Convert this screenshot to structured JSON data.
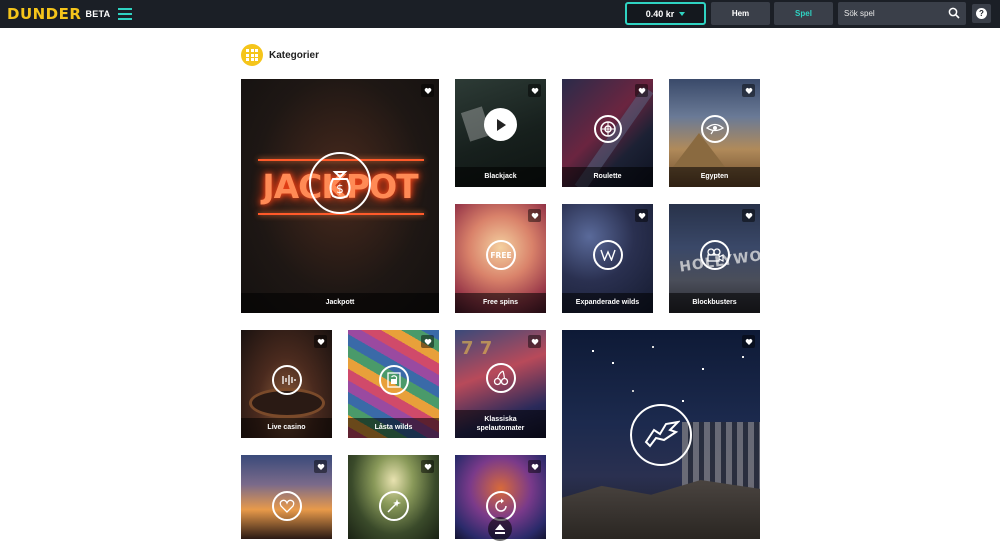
{
  "header": {
    "logo_text": "DUNDER",
    "logo_badge": "BETA",
    "balance": "0.40 kr",
    "nav_home": "Hem",
    "nav_games": "Spel",
    "search_placeholder": "Sök spel",
    "help_label": "?"
  },
  "colors": {
    "accent": "#2fd3c2",
    "brand_yellow": "#f5c51b",
    "topbar": "#1b1f26"
  },
  "section": {
    "title": "Kategorier",
    "icon": "grid-icon"
  },
  "tiles": [
    {
      "label": "Jackpott",
      "icon": "money-bag-icon"
    },
    {
      "label": "Blackjack",
      "icon": "play-icon"
    },
    {
      "label": "Roulette",
      "icon": "roulette-icon"
    },
    {
      "label": "Egypten",
      "icon": "eye-of-horus-icon"
    },
    {
      "label": "Free spins",
      "icon": "free-icon"
    },
    {
      "label": "Expanderade wilds",
      "icon": "w-icon"
    },
    {
      "label": "Blockbusters",
      "icon": "film-camera-icon"
    },
    {
      "label": "Live casino",
      "icon": "live-icon"
    },
    {
      "label": "Låsta wilds",
      "icon": "lock-wild-icon"
    },
    {
      "label": "Klassiska spelautomater",
      "icon": "cherries-icon"
    },
    {
      "label": "",
      "icon": "pegasus-icon"
    },
    {
      "label": "",
      "icon": "heart-icon"
    },
    {
      "label": "",
      "icon": "magic-wand-icon"
    },
    {
      "label": "",
      "icon": "rotate-icon"
    }
  ],
  "jackpot_sign": "JACKPOT"
}
